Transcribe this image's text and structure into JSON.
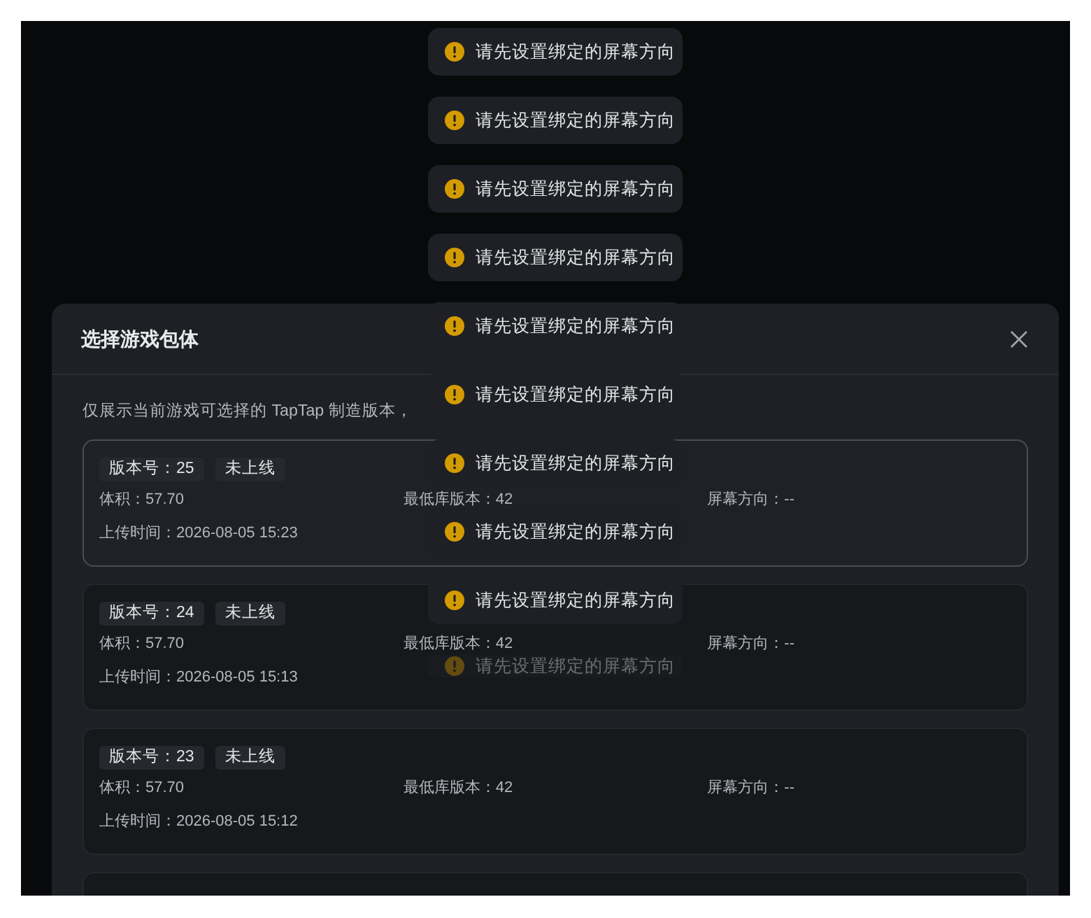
{
  "dialog": {
    "title": "选择游戏包体",
    "intro": "仅展示当前游戏可选择的 TapTap 制造版本，",
    "packages": [
      {
        "version": "版本号：25",
        "status": "未上线",
        "size": "体积：57.70",
        "min_lib": "最低库版本：42",
        "orientation": "屏幕方向：--",
        "uploaded": "上传时间：2026-08-05 15:23",
        "selected": true
      },
      {
        "version": "版本号：24",
        "status": "未上线",
        "size": "体积：57.70",
        "min_lib": "最低库版本：42",
        "orientation": "屏幕方向：--",
        "uploaded": "上传时间：2026-08-05 15:13",
        "selected": false
      },
      {
        "version": "版本号：23",
        "status": "未上线",
        "size": "体积：57.70",
        "min_lib": "最低库版本：42",
        "orientation": "屏幕方向：--",
        "uploaded": "上传时间：2026-08-05 15:12",
        "selected": false
      }
    ]
  },
  "toasts": [
    {
      "text": "请先设置绑定的屏幕方向",
      "fading": false
    },
    {
      "text": "请先设置绑定的屏幕方向",
      "fading": false
    },
    {
      "text": "请先设置绑定的屏幕方向",
      "fading": false
    },
    {
      "text": "请先设置绑定的屏幕方向",
      "fading": false
    },
    {
      "text": "请先设置绑定的屏幕方向",
      "fading": false
    },
    {
      "text": "请先设置绑定的屏幕方向",
      "fading": false
    },
    {
      "text": "请先设置绑定的屏幕方向",
      "fading": false
    },
    {
      "text": "请先设置绑定的屏幕方向",
      "fading": false
    },
    {
      "text": "请先设置绑定的屏幕方向",
      "fading": false
    },
    {
      "text": "请先设置绑定的屏幕方向",
      "fading": true
    }
  ]
}
